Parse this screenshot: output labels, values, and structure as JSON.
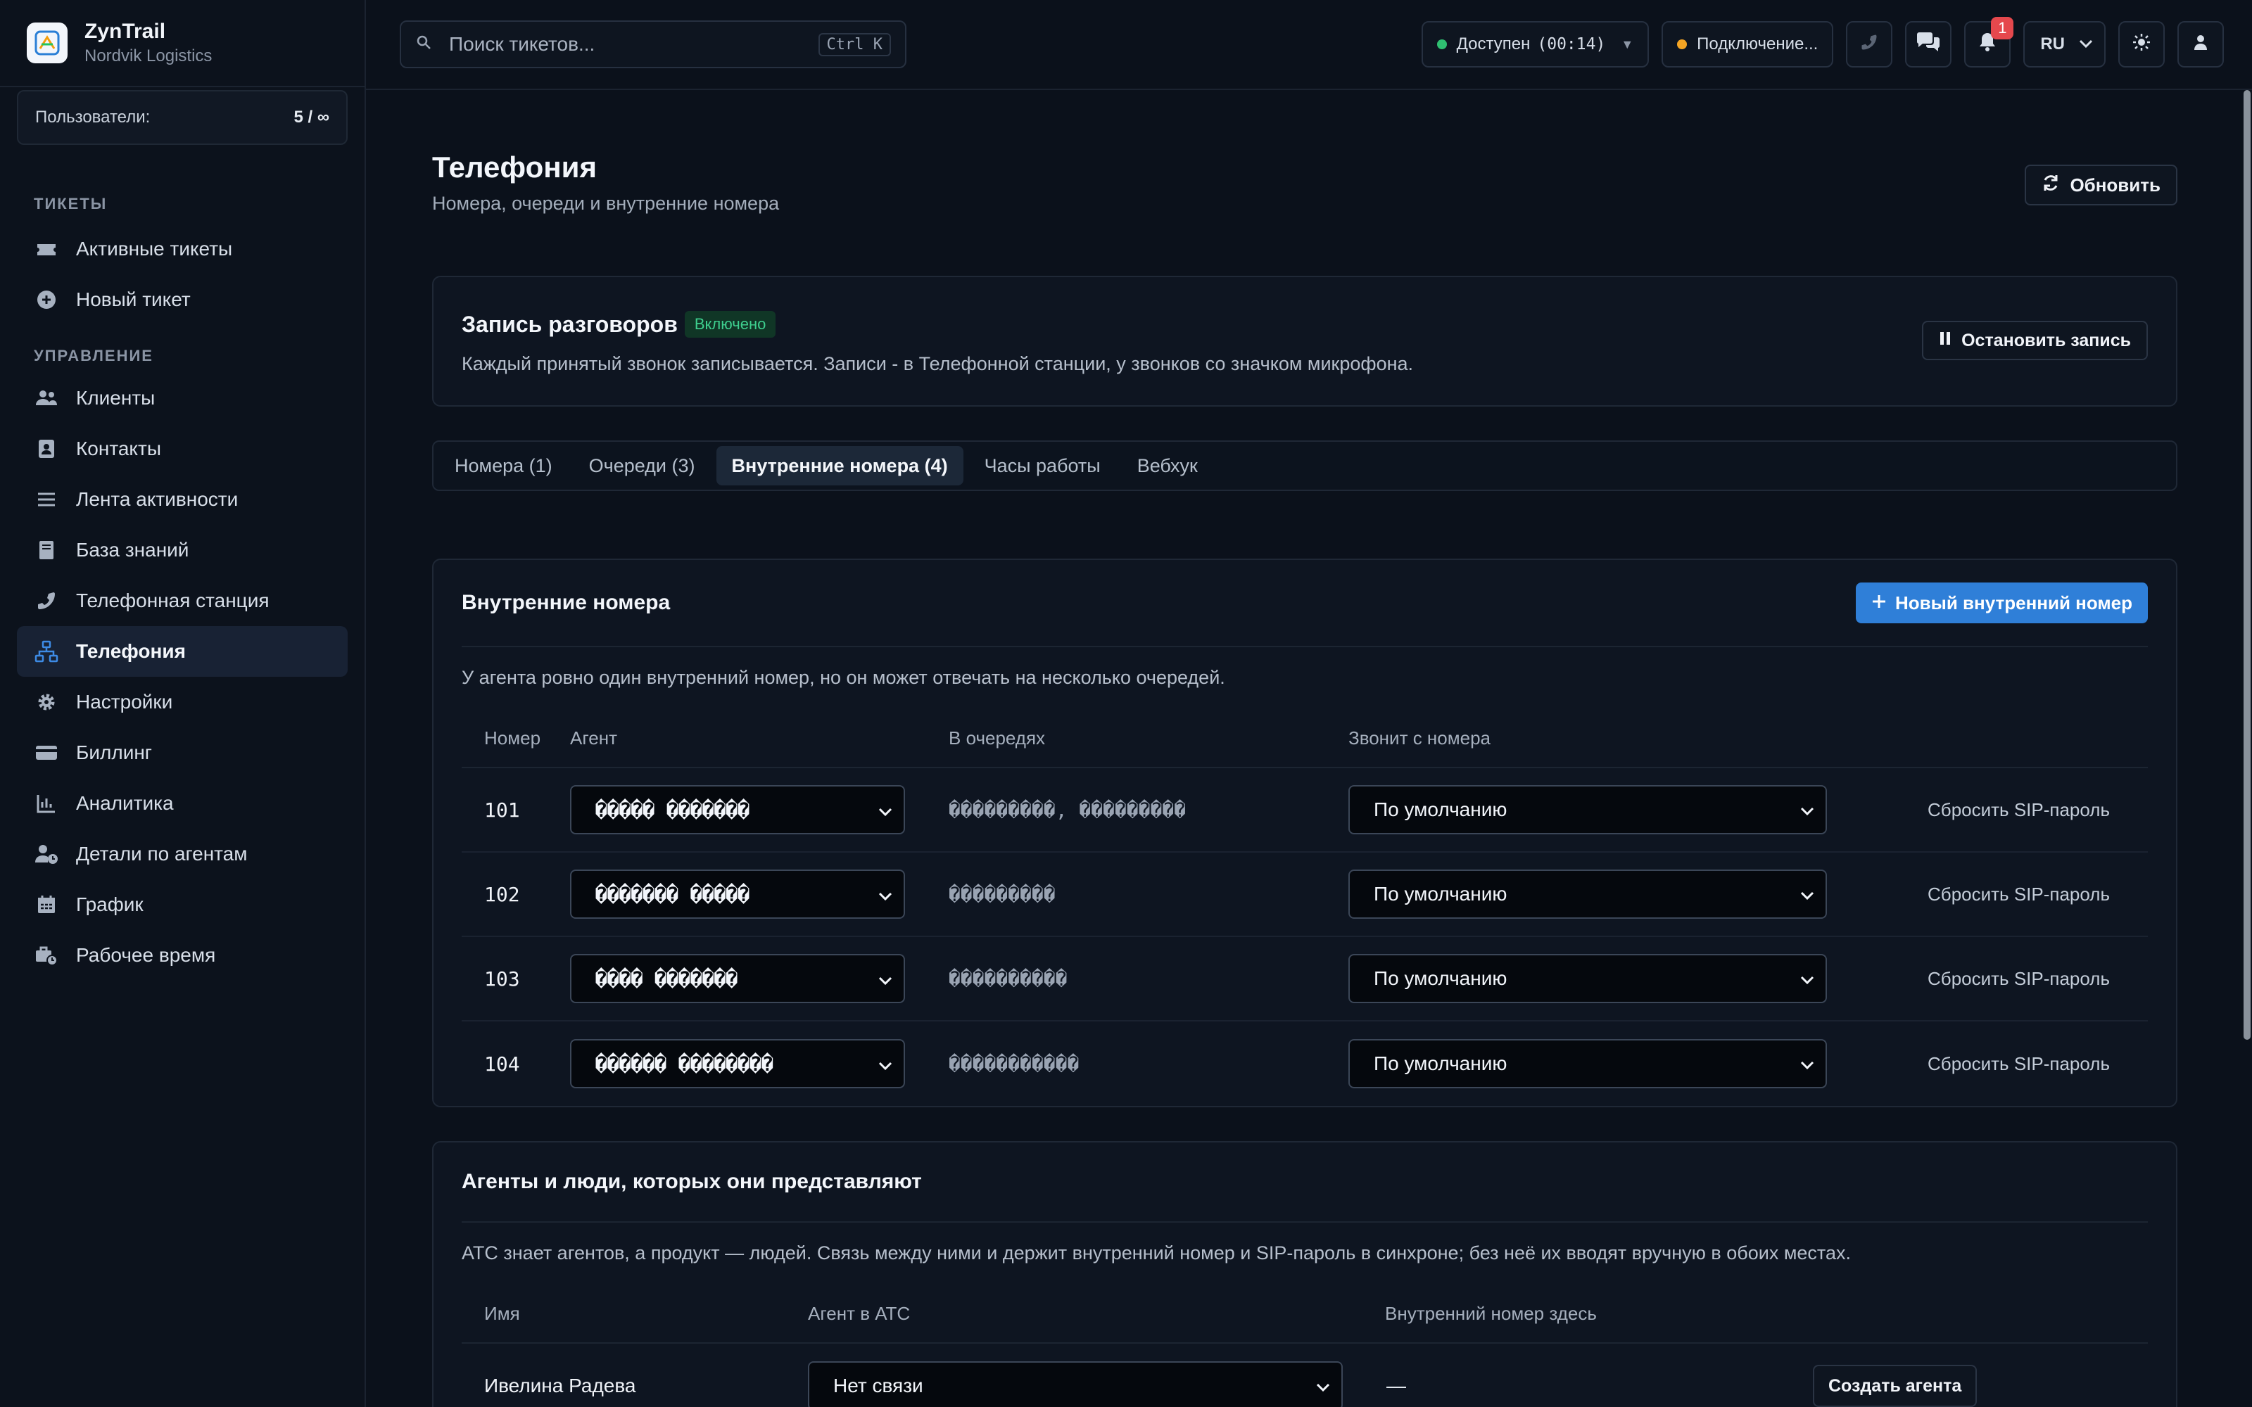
{
  "brand": {
    "name": "ZynTrail",
    "org": "Nordvik Logistics"
  },
  "users": {
    "label": "Пользователи:",
    "value": "5 / ∞"
  },
  "sidebar": {
    "sections": [
      {
        "title": "ТИКЕТЫ",
        "items": [
          {
            "label": "Активные тикеты",
            "icon": "ticket-icon"
          },
          {
            "label": "Новый тикет",
            "icon": "plus-circle-icon"
          }
        ]
      },
      {
        "title": "УПРАВЛЕНИЕ",
        "items": [
          {
            "label": "Клиенты",
            "icon": "users-icon"
          },
          {
            "label": "Контакты",
            "icon": "contact-book-icon"
          },
          {
            "label": "Лента активности",
            "icon": "list-icon"
          },
          {
            "label": "База знаний",
            "icon": "book-icon"
          },
          {
            "label": "Телефонная станция",
            "icon": "phone-icon"
          },
          {
            "label": "Телефония",
            "icon": "network-icon",
            "active": true
          },
          {
            "label": "Настройки",
            "icon": "gear-icon"
          },
          {
            "label": "Биллинг",
            "icon": "credit-card-icon"
          },
          {
            "label": "Аналитика",
            "icon": "chart-icon"
          },
          {
            "label": "Детали по агентам",
            "icon": "user-clock-icon"
          },
          {
            "label": "График",
            "icon": "calendar-icon"
          },
          {
            "label": "Рабочее время",
            "icon": "briefcase-clock-icon"
          }
        ]
      }
    ]
  },
  "topbar": {
    "search_placeholder": "Поиск тикетов...",
    "search_shortcut": "Ctrl K",
    "status_label": "Доступен",
    "status_timer": "(00:14)",
    "connection_label": "Подключение...",
    "notifications_count": "1",
    "language": "RU",
    "colors": {
      "available": "#2fbf71",
      "connecting": "#f5a524"
    }
  },
  "page": {
    "title": "Телефония",
    "subtitle": "Номера, очереди и внутренние номера",
    "refresh_label": "Обновить"
  },
  "recording": {
    "title": "Запись разговоров",
    "status": "Включено",
    "description": "Каждый принятый звонок записывается. Записи - в Телефонной станции, у звонков со значком микрофона.",
    "stop_label": "Остановить запись"
  },
  "tabs": [
    {
      "label": "Номера (1)"
    },
    {
      "label": "Очереди (3)"
    },
    {
      "label": "Внутренние номера (4)",
      "active": true
    },
    {
      "label": "Часы работы"
    },
    {
      "label": "Вебхук"
    }
  ],
  "extensions": {
    "title": "Внутренние номера",
    "new_label": "Новый внутренний номер",
    "description": "У агента ровно один внутренний номер, но он может отвечать на несколько очередей.",
    "columns": [
      "Номер",
      "Агент",
      "В очередях",
      "Звонит с номера"
    ],
    "rows": [
      {
        "number": "101",
        "agent": "����� �������",
        "queues": "���������, ���������",
        "from": "По умолчанию",
        "action": "Сбросить SIP-пароль"
      },
      {
        "number": "102",
        "agent": "������� �����",
        "queues": "���������",
        "from": "По умолчанию",
        "action": "Сбросить SIP-пароль"
      },
      {
        "number": "103",
        "agent": "���� �������",
        "queues": "����������",
        "from": "По умолчанию",
        "action": "Сбросить SIP-пароль"
      },
      {
        "number": "104",
        "agent": "������ ��������",
        "queues": "�����������",
        "from": "По умолчанию",
        "action": "Сбросить SIP-пароль"
      }
    ]
  },
  "agents": {
    "title": "Агенты и люди, которых они представляют",
    "description": "АТС знает агентов, а продукт — людей. Связь между ними и держит внутренний номер и SIP-пароль в синхроне; без неё их вводят вручную в обоих местах.",
    "columns": [
      "Имя",
      "Агент в АТС",
      "Внутренний номер здесь"
    ],
    "rows": [
      {
        "name": "Ивелина Радева",
        "atc": "Нет связи",
        "ext": "—",
        "action": "Создать агента"
      }
    ]
  }
}
